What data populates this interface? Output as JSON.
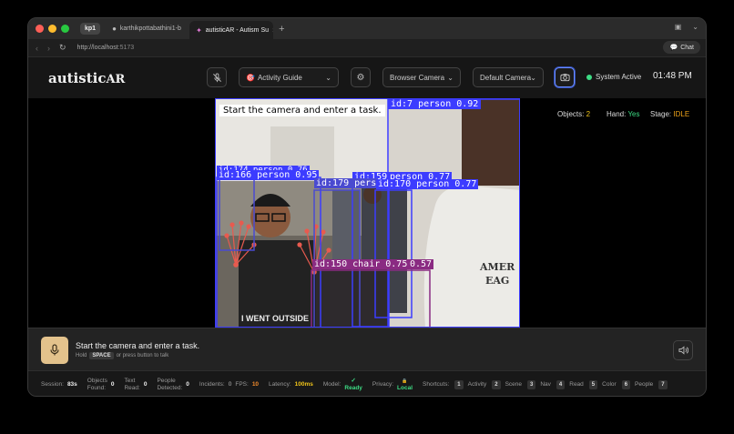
{
  "browser": {
    "profile": "kp1",
    "tabs": [
      {
        "title": "karthikpottabathini1-b",
        "icon": "github-icon"
      },
      {
        "title": "autisticAR - Autism Su",
        "icon": "brain-icon"
      }
    ],
    "url_host": "http://localhost",
    "url_port": ":5173",
    "chat_label": "Chat"
  },
  "app": {
    "logo_main": "autistic",
    "logo_accent": "AR",
    "activity_select": "Activity Guide",
    "source_select": "Browser Camera",
    "camera_select": "Default Camera",
    "status_text": "System Active",
    "clock": "01:48 PM",
    "status_color": "#3ddc84",
    "accent": "#6a8cff"
  },
  "hud": {
    "objects_label": "Objects:",
    "objects_value": "2",
    "hand_label": "Hand:",
    "hand_value": "Yes",
    "stage_label": "Stage:",
    "stage_value": "IDLE"
  },
  "overlay": {
    "banner": "Start the camera and enter a task.",
    "detections": [
      {
        "label": "id:7 person 0.92"
      },
      {
        "label": "id:166 person 0.95"
      },
      {
        "label": "id:174 person 0.76"
      },
      {
        "label": "id:179 pers"
      },
      {
        "label": "id:159"
      },
      {
        "label": "person 0.77"
      },
      {
        "label": "id:170 person 0.77"
      },
      {
        "label": "id:150 chair 0.75"
      },
      {
        "label": "0.57"
      }
    ]
  },
  "prompt": {
    "text": "Start the camera and enter a task.",
    "hint_prefix": "Hold",
    "hint_key": "SPACE",
    "hint_suffix": "or press button to talk"
  },
  "footer": {
    "session_label": "Session:",
    "session_value": "83s",
    "objects_label1": "Objects",
    "objects_label2": "Found:",
    "objects_value": "0",
    "text_label1": "Text",
    "text_label2": "Read:",
    "text_value": "0",
    "people_label1": "People",
    "people_label2": "Detected:",
    "people_value": "0",
    "incidents_label": "Incidents:",
    "incidents_value": "0",
    "fps_label": "FPS:",
    "fps_value": "10",
    "latency_label": "Latency:",
    "latency_value": "100ms",
    "model_label": "Model:",
    "model_check": "✓",
    "model_value": "Ready",
    "privacy_label": "Privacy:",
    "privacy_icon": "🔒",
    "privacy_value": "Local",
    "shortcuts_label": "Shortcuts:",
    "shortcuts": [
      {
        "key": "1",
        "label": "Activity"
      },
      {
        "key": "2",
        "label": "Scene"
      },
      {
        "key": "3",
        "label": "Nav"
      },
      {
        "key": "4",
        "label": "Read"
      },
      {
        "key": "5",
        "label": "Color"
      },
      {
        "key": "6",
        "label": "People"
      },
      {
        "key": "7",
        "label": ""
      }
    ]
  }
}
